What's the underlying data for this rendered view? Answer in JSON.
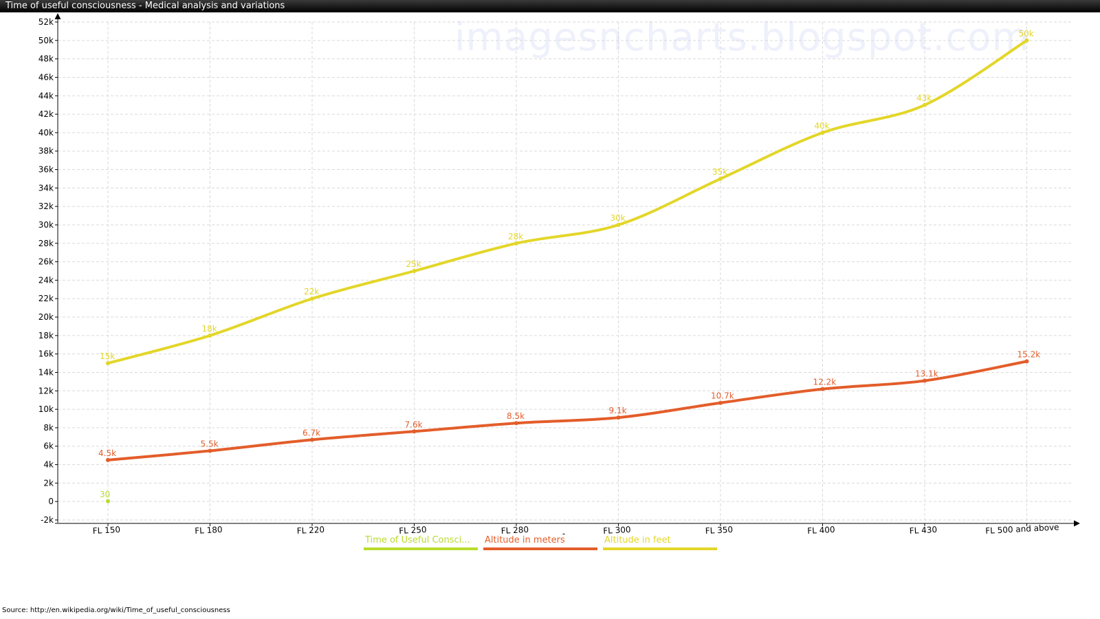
{
  "window": {
    "title": "Time of useful consciousness - Medical analysis and variations"
  },
  "watermark": "imagesncharts.blogspot.com",
  "source": "Source:  http://en.wikipedia.org/wiki/Time_of_useful_consciousness",
  "chart_data": {
    "type": "line",
    "title": "Time of useful consciousness - Medical analysis and variations",
    "xlabel": "-",
    "ylabel": "",
    "categories": [
      "FL 150",
      "FL 180",
      "FL 220",
      "FL 250",
      "FL 280",
      "FL 300",
      "FL 350",
      "FL 400",
      "FL 430",
      "FL 500 and above"
    ],
    "ylim": [
      -2000,
      52000
    ],
    "yticks": [
      -2000,
      0,
      2000,
      4000,
      6000,
      8000,
      10000,
      12000,
      14000,
      16000,
      18000,
      20000,
      22000,
      24000,
      26000,
      28000,
      30000,
      32000,
      34000,
      36000,
      38000,
      40000,
      42000,
      44000,
      46000,
      48000,
      50000,
      52000
    ],
    "ytick_labels": [
      "-2k",
      "0",
      "2k",
      "4k",
      "6k",
      "8k",
      "10k",
      "12k",
      "14k",
      "16k",
      "18k",
      "20k",
      "22k",
      "24k",
      "26k",
      "28k",
      "30k",
      "32k",
      "34k",
      "36k",
      "38k",
      "40k",
      "42k",
      "44k",
      "46k",
      "48k",
      "50k",
      "52k"
    ],
    "grid": true,
    "legend_position": "bottom-center",
    "series": [
      {
        "name": "Time of Useful Consci...",
        "color": "#b8dc2c",
        "values": [
          30,
          null,
          null,
          null,
          null,
          null,
          null,
          null,
          null,
          null
        ],
        "labels": [
          "30",
          "",
          "",
          "",
          "",
          "",
          "",
          "",
          "",
          ""
        ]
      },
      {
        "name": "Altitude in meters",
        "color": "#e35d2a",
        "values": [
          4500,
          5500,
          6700,
          7600,
          8500,
          9100,
          10700,
          12200,
          13100,
          15200
        ],
        "labels": [
          "4.5k",
          "5.5k",
          "6.7k",
          "7.6k",
          "8.5k",
          "9.1k",
          "10.7k",
          "12.2k",
          "13.1k",
          "15.2k"
        ]
      },
      {
        "name": "Altitude in feet",
        "color": "#e3d629",
        "values": [
          15000,
          18000,
          22000,
          25000,
          28000,
          30000,
          35000,
          40000,
          43000,
          50000
        ],
        "labels": [
          "15k",
          "18k",
          "22k",
          "25k",
          "28k",
          "30k",
          "35k",
          "40k",
          "43k",
          "50k"
        ]
      }
    ]
  }
}
